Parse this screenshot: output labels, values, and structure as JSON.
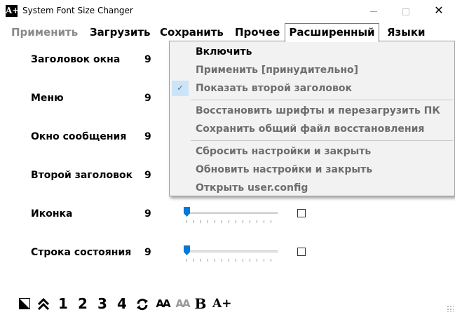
{
  "window": {
    "title": "System Font Size Changer",
    "icon_glyph": "A+",
    "close_glyph": "✕"
  },
  "menu": {
    "apply": "Применить",
    "load": "Загрузить",
    "save": "Сохранить",
    "other": "Прочее",
    "advanced": "Расширенный",
    "languages": "Языки"
  },
  "rows": [
    {
      "label": "Заголовок окна",
      "value": "9"
    },
    {
      "label": "Меню",
      "value": "9"
    },
    {
      "label": "Окно сообщения",
      "value": "9"
    },
    {
      "label": "Второй заголовок",
      "value": "9"
    },
    {
      "label": "Иконка",
      "value": "9"
    },
    {
      "label": "Строка состояния",
      "value": "9"
    }
  ],
  "dropdown": {
    "enable": "Включить",
    "force_apply": "Применить [принудительно]",
    "show_second_title": "Показать второй заголовок",
    "show_second_title_checked": true,
    "restore_fonts_reboot": "Восстановить шрифты и перезагрузить ПК",
    "save_restore_file": "Сохранить общий файл восстановления",
    "reset_close": "Сбросить настройки и закрыть",
    "update_close": "Обновить настройки и закрыть",
    "open_config": "Открыть user.config",
    "check_glyph": "✓"
  },
  "toolbar": {
    "n1": "1",
    "n2": "2",
    "n3": "3",
    "n4": "4",
    "font_small": "AA",
    "font_gray": "AA",
    "bold": "B",
    "font_plus": "A+"
  },
  "colors": {
    "accent": "#0078d7",
    "disabled_text": "#6d6d6d",
    "menu_bg": "#f2f2f2",
    "check_bg": "#cce4f7"
  }
}
